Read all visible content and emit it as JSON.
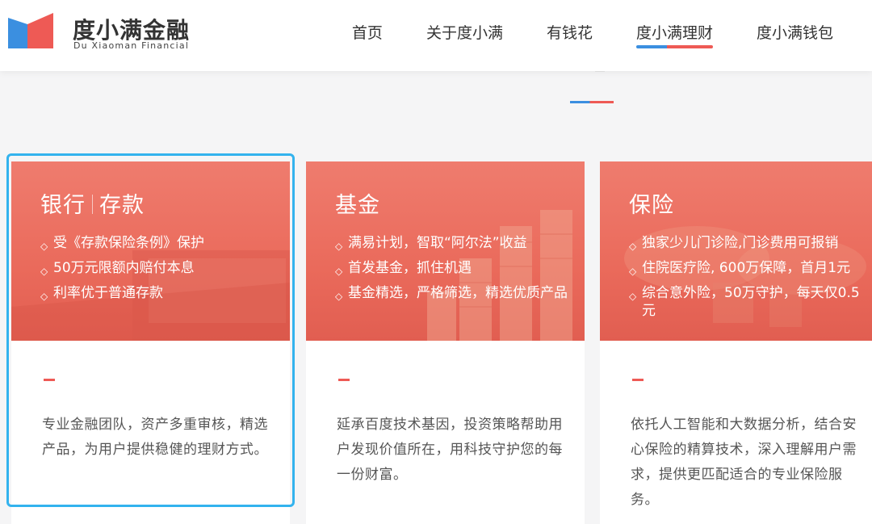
{
  "header": {
    "logo_title": "度小满金融",
    "logo_subtitle": "Du Xiaoman Financial",
    "nav": [
      {
        "label": "首页",
        "active": false
      },
      {
        "label": "关于度小满",
        "active": false
      },
      {
        "label": "有钱花",
        "active": false
      },
      {
        "label": "度小满理财",
        "active": true
      },
      {
        "label": "度小满钱包",
        "active": false
      }
    ]
  },
  "colors": {
    "brand_blue": "#3b8fe0",
    "brand_red": "#ee5a55",
    "selection_outline": "#33b3ee",
    "card_banner": "#ea6a5b"
  },
  "cards": [
    {
      "title_a": "银行",
      "title_b": "存款",
      "bullets": [
        "受《存款保险条例》保护",
        "50万元限额内赔付本息",
        "利率优于普通存款"
      ],
      "description": "专业金融团队，资产多重审核，精选产品，为用户提供稳健的理财方式。"
    },
    {
      "title_a": "基金",
      "title_b": "",
      "bullets": [
        "满易计划，智取“阿尔法”收益",
        "首发基金，抓住机遇",
        "基金精选，严格筛选，精选优质产品"
      ],
      "description": "延承百度技术基因，投资策略帮助用户发现价值所在，用科技守护您的每一份财富。"
    },
    {
      "title_a": "保险",
      "title_b": "",
      "bullets": [
        "独家少儿门诊险,门诊费用可报销",
        "住院医疗险, 600万保障，首月1元",
        "综合意外险，50万守护，每天仅0.5元"
      ],
      "description": "依托人工智能和大数据分析，结合安心保险的精算技术，深入理解用户需求，提供更匹配适合的专业保险服务。"
    }
  ]
}
